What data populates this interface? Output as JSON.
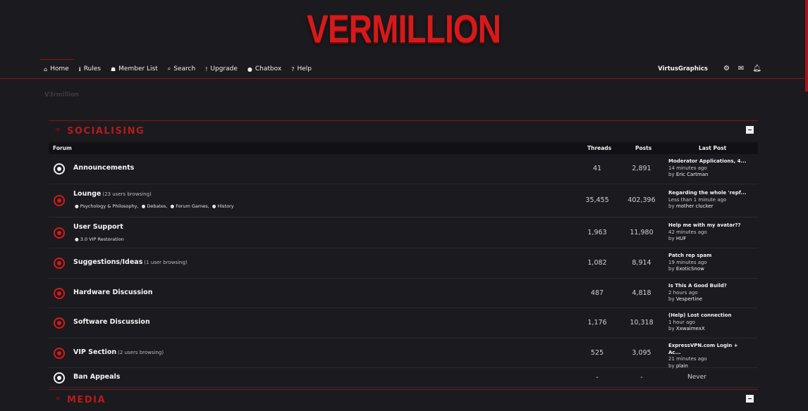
{
  "logo": "VERMILLION",
  "nav": [
    {
      "icon": "⌂",
      "label": "Home",
      "icon_name": "home-icon"
    },
    {
      "icon": "ℹ",
      "label": "Rules",
      "icon_name": "info-icon"
    },
    {
      "icon": "☗",
      "label": "Member List",
      "icon_name": "users-icon"
    },
    {
      "icon": "⌕",
      "label": "Search",
      "icon_name": "search-icon"
    },
    {
      "icon": "!",
      "label": "Upgrade",
      "icon_name": "exclamation-icon"
    },
    {
      "icon": "●",
      "label": "Chatbox",
      "icon_name": "chat-icon"
    },
    {
      "icon": "?",
      "label": "Help",
      "icon_name": "help-icon"
    }
  ],
  "user": {
    "name": "VirtusGraphics",
    "icons": [
      "gear-icon",
      "envelope-icon",
      "bell-icon"
    ]
  },
  "breadcrumb": "V3rmillion",
  "categories": [
    {
      "title": "SOCIALISING",
      "headers": {
        "forum": "Forum",
        "threads": "Threads",
        "posts": "Posts",
        "last": "Last Post"
      },
      "forums": [
        {
          "name": "Announcements",
          "browsing": "",
          "subs": [],
          "threads": "41",
          "posts": "2,891",
          "last_title": "Moderator Applications, 4...",
          "last_time": "14 minutes ago",
          "last_by": "Eric Cartman",
          "icon": "white"
        },
        {
          "name": "Lounge",
          "browsing": "(23 users browsing)",
          "subs": [
            "Psychology & Philosophy,",
            "Debates,",
            "Forum Games,",
            "History"
          ],
          "threads": "35,455",
          "posts": "402,396",
          "last_title": "Regarding the whole 'repf...",
          "last_time": "Less than 1 minute ago",
          "last_by": "mother clucker",
          "icon": "red"
        },
        {
          "name": "User Support",
          "browsing": "",
          "subs": [
            "3.0 VIP Restoration"
          ],
          "threads": "1,963",
          "posts": "11,980",
          "last_title": "Help me with my avatar??",
          "last_time": "42 minutes ago",
          "last_by": "HUF",
          "icon": "red"
        },
        {
          "name": "Suggestions/Ideas",
          "browsing": "(1 user browsing)",
          "subs": [],
          "threads": "1,082",
          "posts": "8,914",
          "last_title": "Patch rep spam",
          "last_time": "19 minutes ago",
          "last_by": "ExoticSnow",
          "icon": "red"
        },
        {
          "name": "Hardware Discussion",
          "browsing": "",
          "subs": [],
          "threads": "487",
          "posts": "4,818",
          "last_title": "Is This A Good Build?",
          "last_time": "2 hours ago",
          "last_by": "Vespertine",
          "icon": "red"
        },
        {
          "name": "Software Discussion",
          "browsing": "",
          "subs": [],
          "threads": "1,176",
          "posts": "10,318",
          "last_title": "(Help) Lost connection",
          "last_time": "1 hour ago",
          "last_by": "XxwaimexX",
          "icon": "red"
        },
        {
          "name": "VIP Section",
          "browsing": "(2 users browsing)",
          "subs": [],
          "threads": "525",
          "posts": "3,095",
          "last_title": "ExpressVPN.com Login + Ac...",
          "last_time": "21 minutes ago",
          "last_by": "plain",
          "icon": "red"
        },
        {
          "name": "Ban Appeals",
          "browsing": "",
          "subs": [],
          "threads": "-",
          "posts": "-",
          "never": "Never",
          "icon": "white"
        }
      ]
    },
    {
      "title": "MEDIA"
    }
  ],
  "colors": {
    "accent": "#d61a1a",
    "background": "#1b1a1f",
    "header_bar": "#111014"
  }
}
